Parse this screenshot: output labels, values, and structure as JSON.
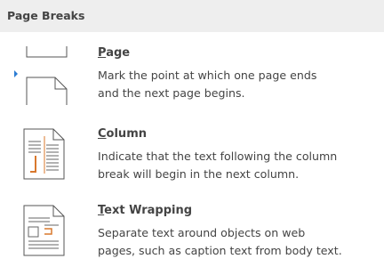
{
  "section": {
    "title": "Page Breaks"
  },
  "items": [
    {
      "mnemonic": "P",
      "title_rest": "age",
      "desc_lines": [
        "Mark the point at which one page ends",
        "and the next page begins."
      ],
      "icon": "page-break-icon"
    },
    {
      "mnemonic": "C",
      "title_rest": "olumn",
      "desc_lines": [
        "Indicate that the text following the column",
        "break will begin in the next column."
      ],
      "icon": "column-break-icon"
    },
    {
      "mnemonic": "T",
      "title_rest": "ext Wrapping",
      "desc_lines": [
        "Separate text around objects on web",
        "pages, such as caption text from body text."
      ],
      "icon": "text-wrapping-break-icon"
    }
  ],
  "colors": {
    "accent": "#d9782d",
    "selection_marker": "#2b7cd3",
    "header_bg": "#eeeeee"
  }
}
